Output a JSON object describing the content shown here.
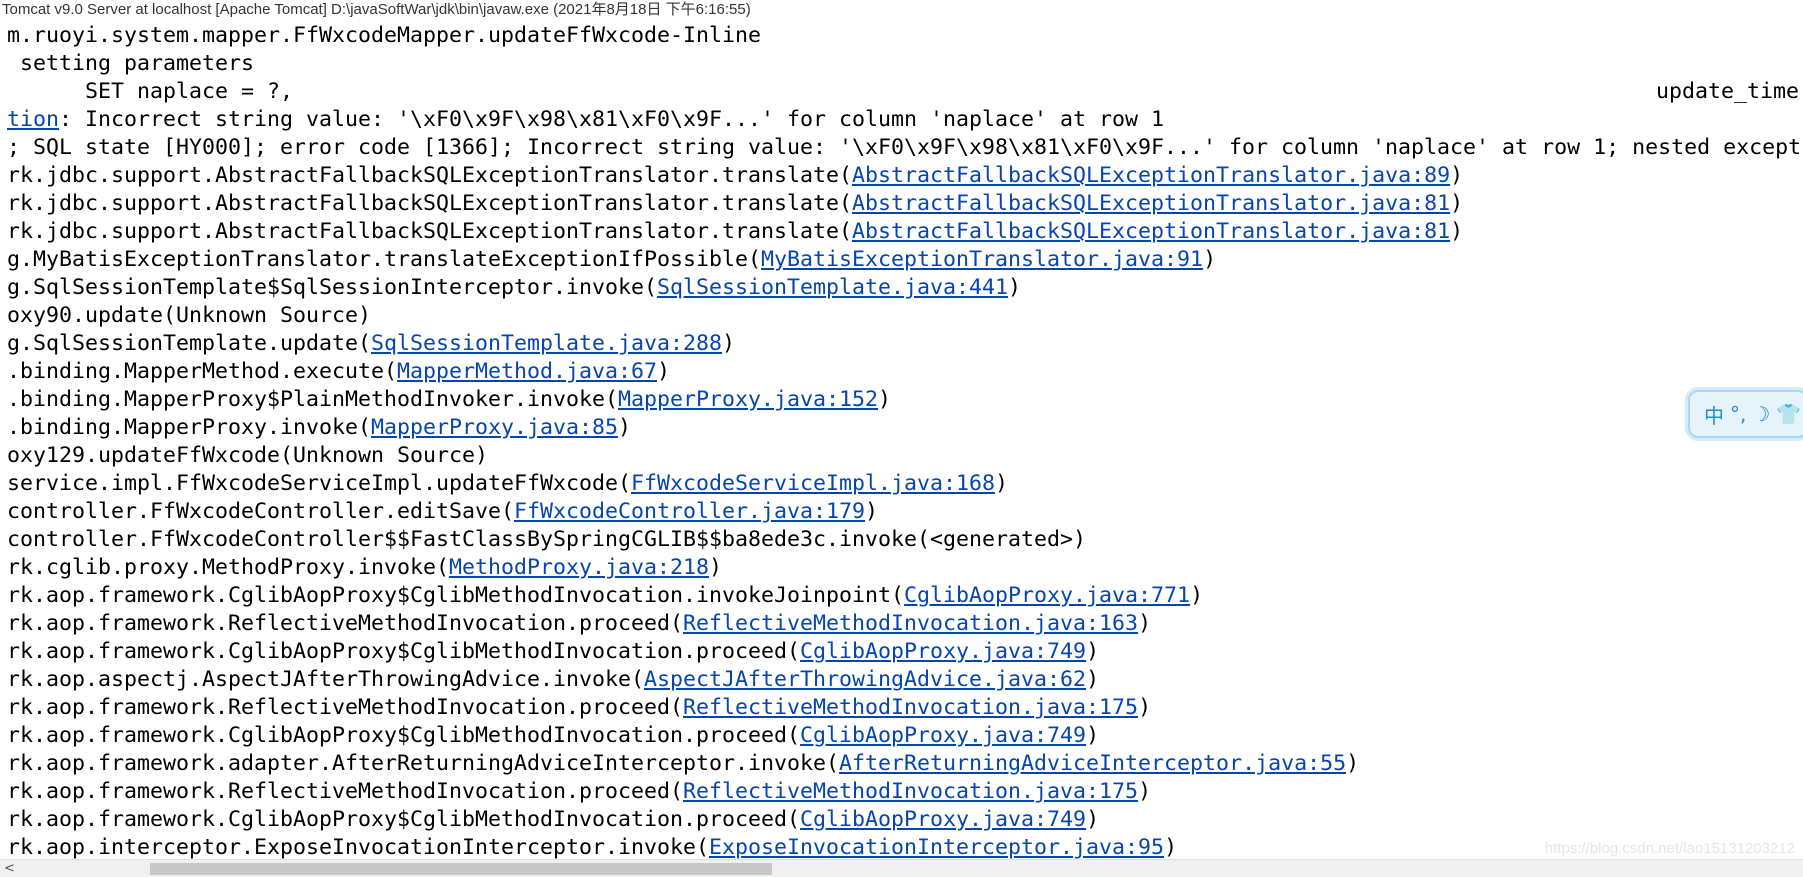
{
  "window": {
    "title": "Tomcat v9.0 Server at localhost [Apache Tomcat] D:\\javaSoftWar\\jdk\\bin\\javaw.exe  (2021年8月18日 下午6:16:55)"
  },
  "console": {
    "right_fragment": "update_time",
    "lines": [
      {
        "text": "m.ruoyi.system.mapper.FfWxcodeMapper.updateFfWxcode-Inline",
        "link": "",
        "suffix": ""
      },
      {
        "text": " setting parameters",
        "link": "",
        "suffix": ""
      },
      {
        "text": "      SET naplace = ?,",
        "link": "",
        "suffix": ""
      },
      {
        "text": "",
        "link": "tion",
        "suffix": ": Incorrect string value: '\\xF0\\x9F\\x98\\x81\\xF0\\x9F...' for column 'naplace' at row 1"
      },
      {
        "text": "; SQL state [HY000]; error code [1366]; Incorrect string value: '\\xF0\\x9F\\x98\\x81\\xF0\\x9F...' for column 'naplace' at row 1; nested except",
        "link": "",
        "suffix": ""
      },
      {
        "text": "rk.jdbc.support.AbstractFallbackSQLExceptionTranslator.translate(",
        "link": "AbstractFallbackSQLExceptionTranslator.java:89",
        "suffix": ")"
      },
      {
        "text": "rk.jdbc.support.AbstractFallbackSQLExceptionTranslator.translate(",
        "link": "AbstractFallbackSQLExceptionTranslator.java:81",
        "suffix": ")"
      },
      {
        "text": "rk.jdbc.support.AbstractFallbackSQLExceptionTranslator.translate(",
        "link": "AbstractFallbackSQLExceptionTranslator.java:81",
        "suffix": ")"
      },
      {
        "text": "g.MyBatisExceptionTranslator.translateExceptionIfPossible(",
        "link": "MyBatisExceptionTranslator.java:91",
        "suffix": ")"
      },
      {
        "text": "g.SqlSessionTemplate$SqlSessionInterceptor.invoke(",
        "link": "SqlSessionTemplate.java:441",
        "suffix": ")"
      },
      {
        "text": "oxy90.update(Unknown Source)",
        "link": "",
        "suffix": ""
      },
      {
        "text": "g.SqlSessionTemplate.update(",
        "link": "SqlSessionTemplate.java:288",
        "suffix": ")"
      },
      {
        "text": ".binding.MapperMethod.execute(",
        "link": "MapperMethod.java:67",
        "suffix": ")"
      },
      {
        "text": ".binding.MapperProxy$PlainMethodInvoker.invoke(",
        "link": "MapperProxy.java:152",
        "suffix": ")"
      },
      {
        "text": ".binding.MapperProxy.invoke(",
        "link": "MapperProxy.java:85",
        "suffix": ")"
      },
      {
        "text": "oxy129.updateFfWxcode(Unknown Source)",
        "link": "",
        "suffix": ""
      },
      {
        "text": "service.impl.FfWxcodeServiceImpl.updateFfWxcode(",
        "link": "FfWxcodeServiceImpl.java:168",
        "suffix": ")"
      },
      {
        "text": "controller.FfWxcodeController.editSave(",
        "link": "FfWxcodeController.java:179",
        "suffix": ")"
      },
      {
        "text": "controller.FfWxcodeController$$FastClassBySpringCGLIB$$ba8ede3c.invoke(<generated>)",
        "link": "",
        "suffix": ""
      },
      {
        "text": "rk.cglib.proxy.MethodProxy.invoke(",
        "link": "MethodProxy.java:218",
        "suffix": ")"
      },
      {
        "text": "rk.aop.framework.CglibAopProxy$CglibMethodInvocation.invokeJoinpoint(",
        "link": "CglibAopProxy.java:771",
        "suffix": ")"
      },
      {
        "text": "rk.aop.framework.ReflectiveMethodInvocation.proceed(",
        "link": "ReflectiveMethodInvocation.java:163",
        "suffix": ")"
      },
      {
        "text": "rk.aop.framework.CglibAopProxy$CglibMethodInvocation.proceed(",
        "link": "CglibAopProxy.java:749",
        "suffix": ")"
      },
      {
        "text": "rk.aop.aspectj.AspectJAfterThrowingAdvice.invoke(",
        "link": "AspectJAfterThrowingAdvice.java:62",
        "suffix": ")"
      },
      {
        "text": "rk.aop.framework.ReflectiveMethodInvocation.proceed(",
        "link": "ReflectiveMethodInvocation.java:175",
        "suffix": ")"
      },
      {
        "text": "rk.aop.framework.CglibAopProxy$CglibMethodInvocation.proceed(",
        "link": "CglibAopProxy.java:749",
        "suffix": ")"
      },
      {
        "text": "rk.aop.framework.adapter.AfterReturningAdviceInterceptor.invoke(",
        "link": "AfterReturningAdviceInterceptor.java:55",
        "suffix": ")"
      },
      {
        "text": "rk.aop.framework.ReflectiveMethodInvocation.proceed(",
        "link": "ReflectiveMethodInvocation.java:175",
        "suffix": ")"
      },
      {
        "text": "rk.aop.framework.CglibAopProxy$CglibMethodInvocation.proceed(",
        "link": "CglibAopProxy.java:749",
        "suffix": ")"
      },
      {
        "text": "rk.aop.interceptor.ExposeInvocationInterceptor.invoke(",
        "link": "ExposeInvocationInterceptor.java:95",
        "suffix": ")"
      }
    ]
  },
  "ime_toolbar": {
    "label": "中",
    "icons": [
      "punctuation-icon",
      "moon-icon",
      "shirt-icon"
    ],
    "color": "#1a8fd6"
  },
  "scrollbar": {
    "left_arrow": "<"
  },
  "watermark": "https://blog.csdn.net/lao15131203212"
}
